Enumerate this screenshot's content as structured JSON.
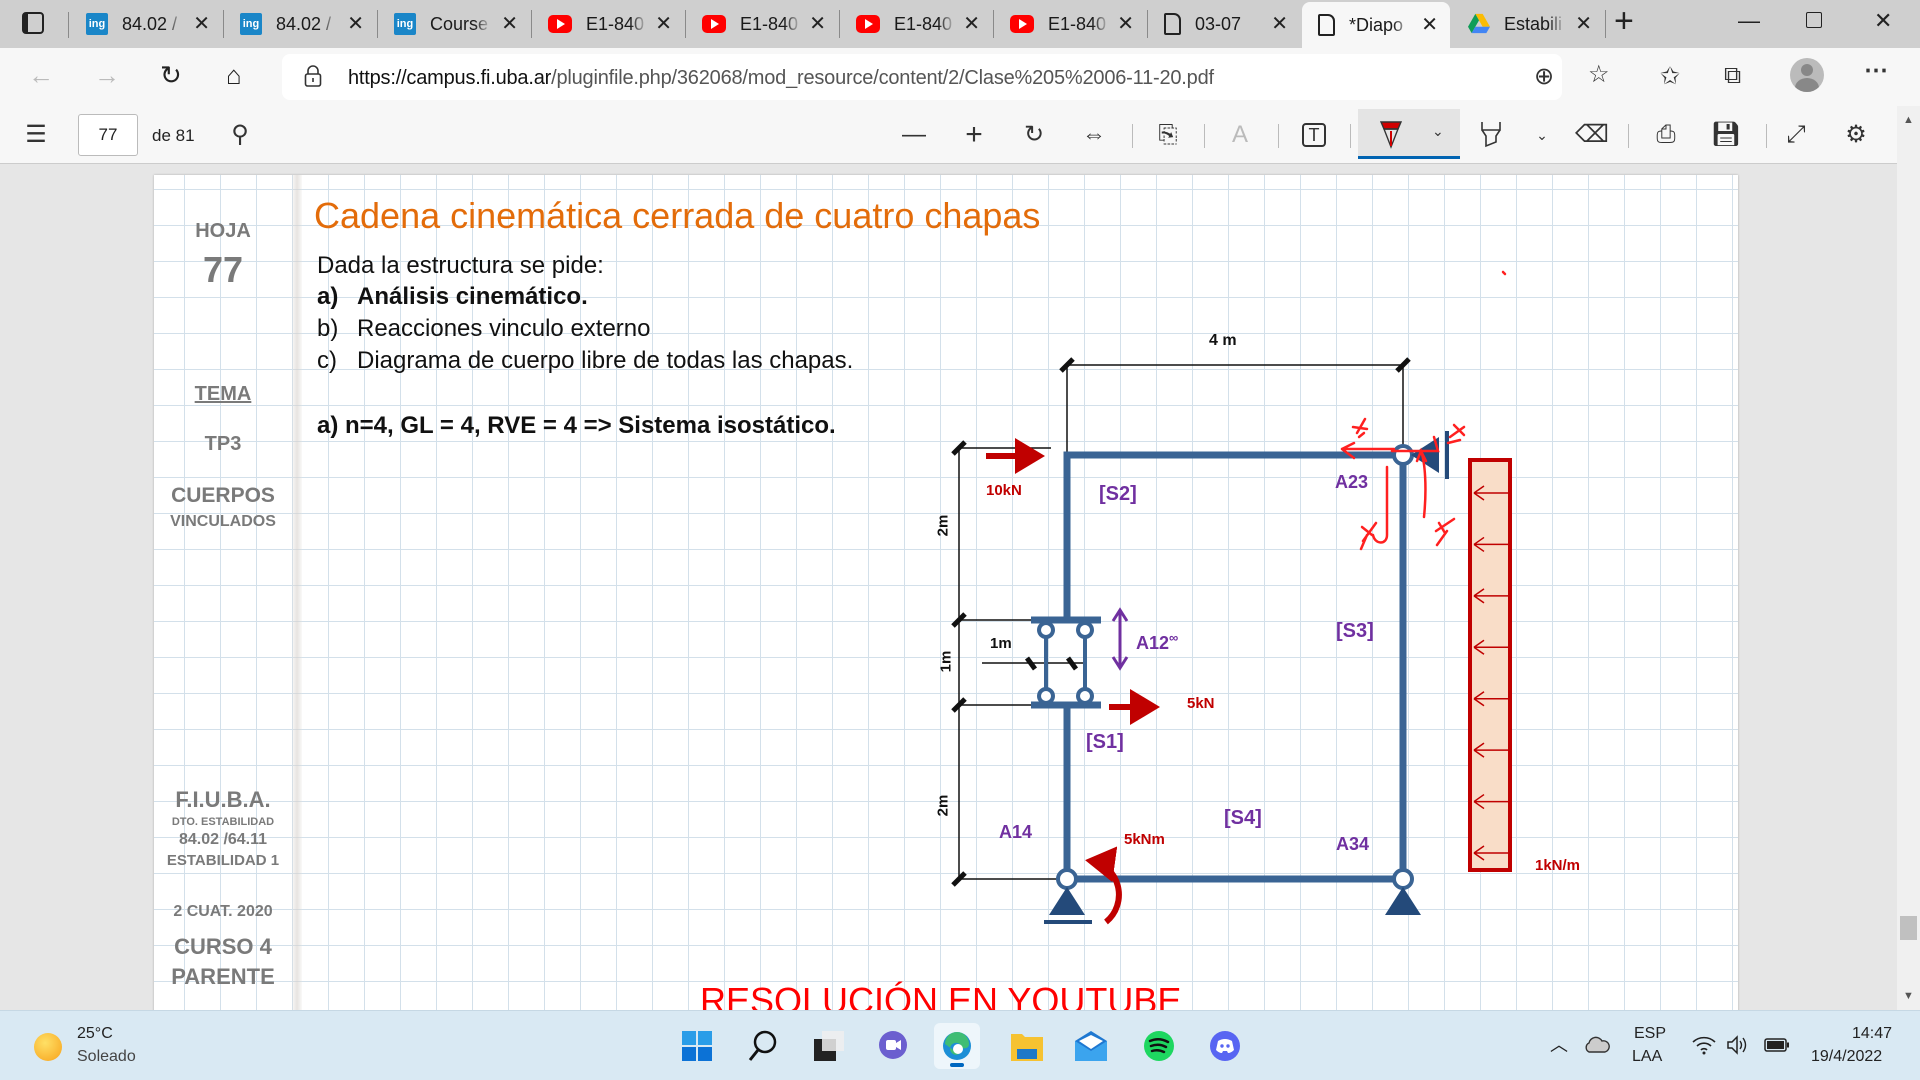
{
  "browser": {
    "tabs": [
      {
        "title": "84.02 /",
        "icon": "ing-favicon",
        "active": false
      },
      {
        "title": "84.02 /",
        "icon": "ing-favicon",
        "active": false
      },
      {
        "title": "Course",
        "icon": "ing-favicon",
        "active": false
      },
      {
        "title": "E1-840",
        "icon": "youtube-icon",
        "active": false
      },
      {
        "title": "E1-840",
        "icon": "youtube-icon",
        "active": false
      },
      {
        "title": "E1-840",
        "icon": "youtube-icon",
        "active": false
      },
      {
        "title": "E1-840",
        "icon": "youtube-icon",
        "active": false
      },
      {
        "title": "03-07",
        "icon": "document-icon",
        "active": false
      },
      {
        "title": "*Diapo",
        "icon": "document-icon",
        "active": true
      },
      {
        "title": "Estabili",
        "icon": "google-drive-icon",
        "active": false
      }
    ],
    "favicon_text": "ing",
    "close_glyph": "✕",
    "new_tab_glyph": "+",
    "url_host": "https://campus.fi.uba.ar",
    "url_path": "/pluginfile.php/362068/mod_resource/content/2/Clase%205%2006-11-20.pdf"
  },
  "pdf_toolbar": {
    "current_page": "77",
    "page_count_label": "de 81",
    "active_tool": "draw",
    "draw_color": "#d00000"
  },
  "document": {
    "sidebar": {
      "hoja_label": "HOJA",
      "hoja_number": "77",
      "tema_label": "TEMA",
      "tema_value": "TP3",
      "topic_line1": "CUERPOS",
      "topic_line2": "VINCULADOS",
      "institution": "F.I.U.B.A.",
      "department": "DTO. ESTABILIDAD",
      "course_code": "84.02 /64.11",
      "course_name": "ESTABILIDAD 1",
      "term": "2 CUAT. 2020",
      "curso_line1": "CURSO 4",
      "curso_line2": "PARENTE"
    },
    "title": "Cadena cinemática cerrada de cuatro chapas",
    "intro": "Dada la estructura se pide:",
    "items": [
      {
        "label": "a)",
        "text": "Análisis cinemático.",
        "bold": true
      },
      {
        "label": "b)",
        "text": "Reacciones vinculo externo",
        "bold": false
      },
      {
        "label": "c)",
        "text": "Diagrama de cuerpo libre de todas las chapas.",
        "bold": false
      }
    ],
    "answer": "a) n=4, GL = 4, RVE = 4 => Sistema isostático.",
    "footer_heading": "RESOLUCIÓN EN YOUTUBE",
    "title_color": "#e36c0a",
    "diagram": {
      "dim_width": "4 m",
      "dim_left_top": "2m",
      "dim_left_mid": "1m",
      "dim_left_bottom": "2m",
      "dim_inner": "1m",
      "load_top": "10kN",
      "load_mid": "5kN",
      "moment": "5kNm",
      "distributed_load": "1kN/m",
      "plates": [
        "[S1]",
        "[S2]",
        "[S3]",
        "[S4]"
      ],
      "joints": [
        "A12",
        "A23",
        "A14",
        "A34"
      ],
      "infinity_glyph": "∞",
      "structure_color": "#3a6494",
      "load_color": "#c00000",
      "label_color": "#7030a0",
      "annotation_color": "#ff2020",
      "annotation_marks": [
        "X",
        "Y"
      ]
    }
  },
  "taskbar": {
    "temperature": "25°C",
    "weather": "Soleado",
    "language_line1": "ESP",
    "language_line2": "LAA",
    "time": "14:47",
    "date": "19/4/2022",
    "pinned_apps": [
      "start",
      "search",
      "task-view",
      "teams-chat",
      "edge",
      "file-explorer",
      "mail",
      "spotify",
      "discord"
    ]
  }
}
